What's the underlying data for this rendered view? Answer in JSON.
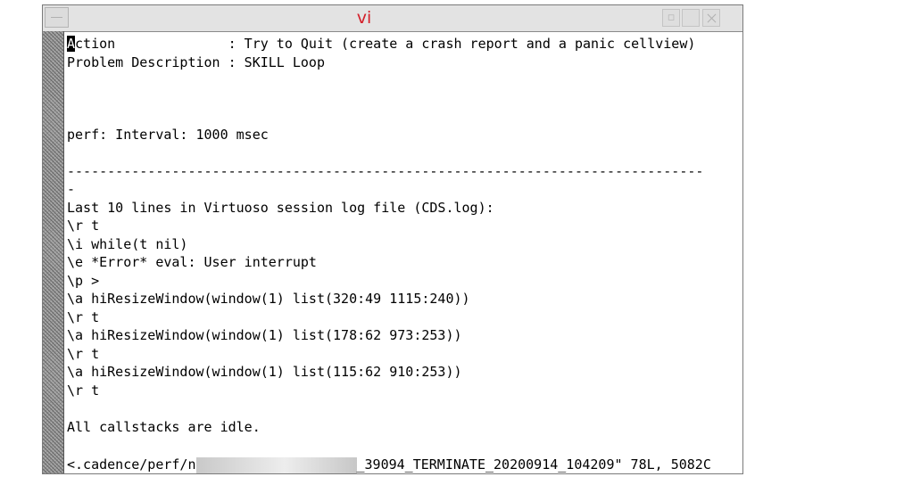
{
  "window": {
    "title": "vi",
    "minimize_glyph": "▫",
    "icons": {
      "menu": "window-menu-icon",
      "minimize": "minimize-icon",
      "maximize": "maximize-icon",
      "close": "close-icon"
    }
  },
  "editor": {
    "cursor_char": "A",
    "lines": [
      "ction              : Try to Quit (create a crash report and a panic cellview)",
      "Problem Description : SKILL Loop",
      "perf: Interval: 1000 msec",
      "-------------------------------------------------------------------------------",
      "-",
      "Last 10 lines in Virtuoso session log file (CDS.log):",
      "\\r t",
      "\\i while(t nil)",
      "\\e *Error* eval: User interrupt",
      "\\p >",
      "\\a hiResizeWindow(window(1) list(320:49 1115:240))",
      "\\r t",
      "\\a hiResizeWindow(window(1) list(178:62 973:253))",
      "\\r t",
      "\\a hiResizeWindow(window(1) list(115:62 910:253))",
      "\\r t",
      "All callstacks are idle."
    ],
    "status": {
      "prefix": "<.cadence/perf/n",
      "suffix": "_39094_TERMINATE_20200914_104209\" 78L, 5082C"
    }
  }
}
